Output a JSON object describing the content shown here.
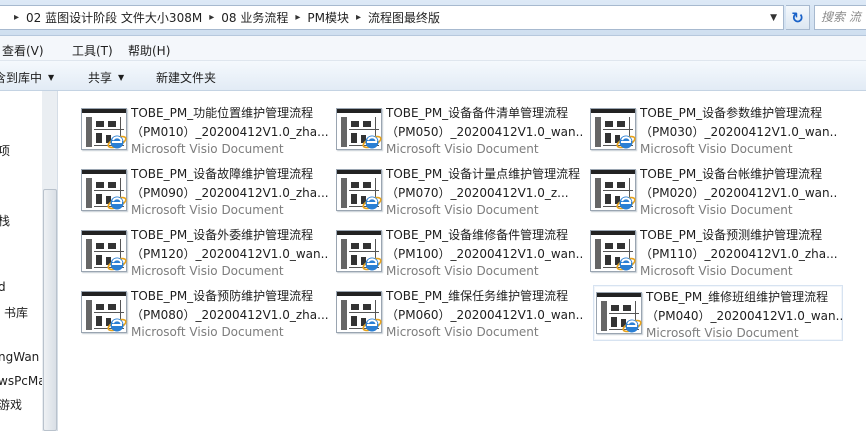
{
  "address": {
    "crumbs": [
      "02 蓝图设计阶段 文件大小308M",
      "08 业务流程",
      "PM模块",
      "流程图最终版"
    ],
    "search_placeholder": "搜索 流"
  },
  "menu": {
    "items": [
      "查看(V)",
      "工具(T)",
      "帮助(H)"
    ]
  },
  "toolbar": {
    "library_label": "含到库中",
    "share_label": "共享",
    "newfolder_label": "新建文件夹"
  },
  "nav": {
    "items": [
      "项",
      "栈",
      "d",
      "书库",
      "ngWan",
      "wsPcMa",
      "游戏"
    ]
  },
  "files": [
    {
      "name": "TOBE_PM_功能位置维护管理流程",
      "code": "（PM010）_20200412V1.0_zha...",
      "type": "Microsoft Visio Document",
      "selected": false
    },
    {
      "name": "TOBE_PM_设备备件清单管理流程",
      "code": "（PM050）_20200412V1.0_wan...",
      "type": "Microsoft Visio Document",
      "selected": false
    },
    {
      "name": "TOBE_PM_设备参数维护管理流程",
      "code": "（PM030）_20200412V1.0_wan...",
      "type": "Microsoft Visio Document",
      "selected": false
    },
    {
      "name": "TOBE_PM_设备故障维护管理流程",
      "code": "（PM090）_20200412V1.0_zha...",
      "type": "Microsoft Visio Document",
      "selected": false
    },
    {
      "name": "TOBE_PM_设备计量点维护管理流程",
      "code": "（PM070）_20200412V1.0_z...",
      "type": "Microsoft Visio Document",
      "selected": false
    },
    {
      "name": "TOBE_PM_设备台帐维护管理流程",
      "code": "（PM020）_20200412V1.0_wan...",
      "type": "Microsoft Visio Document",
      "selected": false
    },
    {
      "name": "TOBE_PM_设备外委维护管理流程",
      "code": "（PM120）_20200412V1.0_wan...",
      "type": "Microsoft Visio Document",
      "selected": false
    },
    {
      "name": "TOBE_PM_设备维修备件管理流程",
      "code": "（PM100）_20200412V1.0_wan...",
      "type": "Microsoft Visio Document",
      "selected": false
    },
    {
      "name": "TOBE_PM_设备预测维护管理流程",
      "code": "（PM110）_20200412V1.0_zha...",
      "type": "Microsoft Visio Document",
      "selected": false
    },
    {
      "name": "TOBE_PM_设备预防维护管理流程",
      "code": "（PM080）_20200412V1.0_zha...",
      "type": "Microsoft Visio Document",
      "selected": false
    },
    {
      "name": "TOBE_PM_维保任务维护管理流程",
      "code": "（PM060）_20200412V1.0_wan...",
      "type": "Microsoft Visio Document",
      "selected": false
    },
    {
      "name": "TOBE_PM_维修班组维护管理流程",
      "code": "（PM040）_20200412V1.0_wan...",
      "type": "Microsoft Visio Document",
      "selected": true
    }
  ]
}
